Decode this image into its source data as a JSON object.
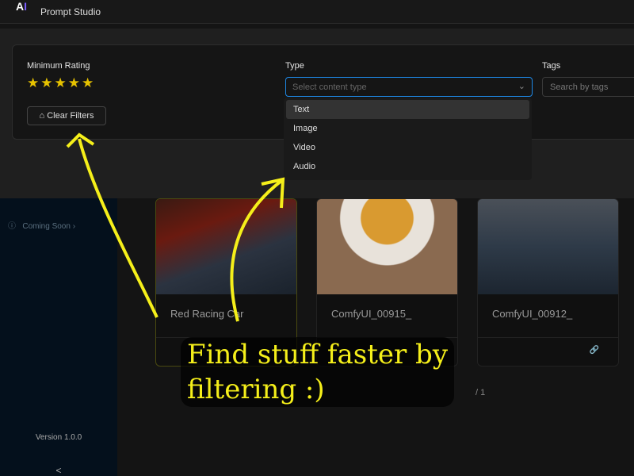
{
  "app": {
    "logo": "AI",
    "title": "Prompt Studio"
  },
  "sidebar": {
    "item": "Coming Soon",
    "version": "Version 1.0.0",
    "collapse": "<"
  },
  "filters": {
    "rating_label": "Minimum Rating",
    "stars": "★★★★★",
    "rating_value": 5,
    "clear_label": "Clear Filters",
    "type_label": "Type",
    "type_placeholder": "Select content type",
    "tags_label": "Tags",
    "tags_placeholder": "Search by tags",
    "type_options": [
      "Text",
      "Image",
      "Video",
      "Audio"
    ]
  },
  "cards": [
    {
      "name": "Red Racing Car"
    },
    {
      "name": "ComfyUI_00915_"
    },
    {
      "name": "ComfyUI_00912_"
    }
  ],
  "pager": {
    "text": "/ 1"
  },
  "annotation": {
    "line1": "Find stuff faster by",
    "line2": "filtering :)"
  },
  "colors": {
    "accent": "#1e88e5",
    "star": "#e6c200",
    "annotation": "#f5ef1a"
  }
}
